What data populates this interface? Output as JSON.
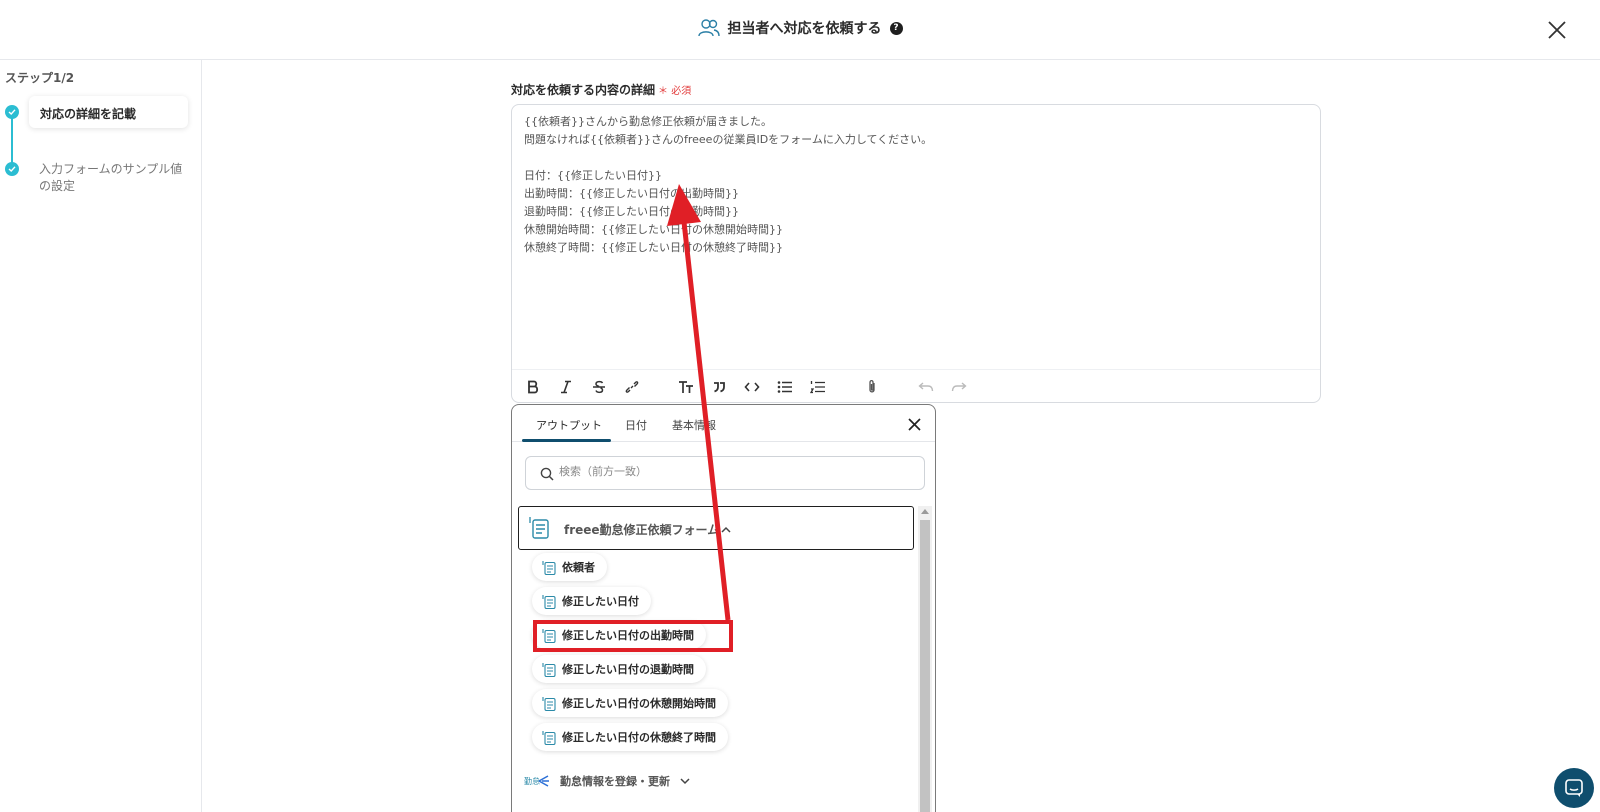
{
  "header": {
    "title": "担当者へ対応を依頼する",
    "help_glyph": "?"
  },
  "sidebar": {
    "step_label": "ステップ1/2",
    "steps": [
      {
        "label": "対応の詳細を記載"
      },
      {
        "label": "入力フォームのサンプル値の設定"
      }
    ]
  },
  "form": {
    "label": "対応を依頼する内容の詳細",
    "required_text": "必須",
    "body_text": "{{依頼者}}さんから勤怠修正依頼が届きました。\n問題なければ{{依頼者}}さんのfreeeの従業員IDをフォームに入力してください。\n\n日付：{{修正したい日付}}\n出勤時間：{{修正したい日付の出勤時間}}\n退勤時間：{{修正したい日付の退勤時間}}\n休憩開始時間：{{修正したい日付の休憩開始時間}}\n休憩終了時間：{{修正したい日付の休憩終了時間}}"
  },
  "toolbar": {
    "items": [
      "bold-icon",
      "italic-icon",
      "strikethrough-icon",
      "link-icon",
      "text-size-icon",
      "quote-icon",
      "code-icon",
      "bullet-list-icon",
      "numbered-list-icon",
      "attachment-icon",
      "undo-icon",
      "redo-icon"
    ]
  },
  "popup": {
    "tabs": [
      {
        "label": "アウトプット",
        "active": true
      },
      {
        "label": "日付",
        "active": false
      },
      {
        "label": "基本情報",
        "active": false
      }
    ],
    "search_placeholder": "検索（前方一致）",
    "group_title": "freee勤怠修正依頼フォーム",
    "chips": [
      {
        "label": "依頼者"
      },
      {
        "label": "修正したい日付"
      },
      {
        "label": "修正したい日付の出勤時間",
        "highlighted": true
      },
      {
        "label": "修正したい日付の退勤時間"
      },
      {
        "label": "修正したい日付の休憩開始時間"
      },
      {
        "label": "修正したい日付の休憩終了時間"
      }
    ],
    "group2_title": "勤怠情報を登録・更新"
  },
  "colors": {
    "accent": "#2bbdd2",
    "brand_dark": "#0f4e6e",
    "highlight_red": "#e01f26",
    "required_red": "#e23b3b"
  }
}
